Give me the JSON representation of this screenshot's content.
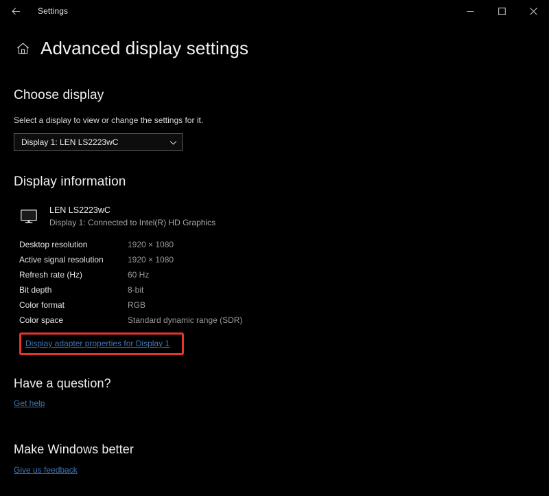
{
  "titlebar": {
    "back_icon": "back-arrow-icon",
    "app_title": "Settings",
    "minimize_label": "─",
    "maximize_label": "□",
    "close_label": "✕"
  },
  "header": {
    "home_icon": "home-icon",
    "title": "Advanced display settings"
  },
  "choose_display": {
    "heading": "Choose display",
    "description": "Select a display to view or change the settings for it.",
    "dropdown": {
      "selected": "Display 1: LEN LS2223wC",
      "chevron_icon": "chevron-down-icon"
    }
  },
  "display_information": {
    "heading": "Display information",
    "monitor_icon": "monitor-icon",
    "monitor_name": "LEN LS2223wC",
    "monitor_connection": "Display 1: Connected to Intel(R) HD Graphics",
    "specs": [
      {
        "label": "Desktop resolution",
        "value": "1920 × 1080"
      },
      {
        "label": "Active signal resolution",
        "value": "1920 × 1080"
      },
      {
        "label": "Refresh rate (Hz)",
        "value": "60 Hz"
      },
      {
        "label": "Bit depth",
        "value": "8-bit"
      },
      {
        "label": "Color format",
        "value": "RGB"
      },
      {
        "label": "Color space",
        "value": "Standard dynamic range (SDR)"
      }
    ],
    "adapter_link": "Display adapter properties for Display 1"
  },
  "have_a_question": {
    "heading": "Have a question?",
    "link": "Get help"
  },
  "make_windows_better": {
    "heading": "Make Windows better",
    "link": "Give us feedback"
  },
  "colors": {
    "background": "#000000",
    "link": "#3f76b5",
    "highlight_box": "#e8332f",
    "label_text": "#e6e6e6",
    "value_text": "#9a9a9a"
  }
}
